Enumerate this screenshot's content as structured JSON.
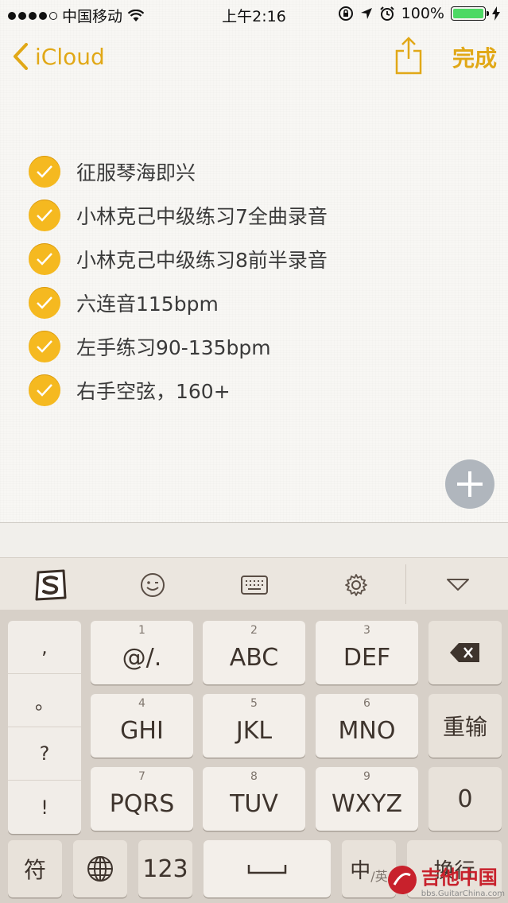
{
  "status": {
    "carrier": "中国移动",
    "time": "上午2:16",
    "battery": "100%"
  },
  "nav": {
    "back_label": "iCloud",
    "done_label": "完成"
  },
  "checklist": [
    "征服琴海即兴",
    "小林克己中级练习7全曲录音",
    "小林克己中级练习8前半录音",
    "六连音115bpm",
    "左手练习90-135bpm",
    "右手空弦，160+"
  ],
  "keyboard": {
    "punct": [
      ",",
      "。",
      "?",
      "!"
    ],
    "row1": [
      {
        "num": "1",
        "label": "@/."
      },
      {
        "num": "2",
        "label": "ABC"
      },
      {
        "num": "3",
        "label": "DEF"
      }
    ],
    "row2": [
      {
        "num": "4",
        "label": "GHI"
      },
      {
        "num": "5",
        "label": "JKL"
      },
      {
        "num": "6",
        "label": "MNO"
      }
    ],
    "row3": [
      {
        "num": "7",
        "label": "PQRS"
      },
      {
        "num": "8",
        "label": "TUV"
      },
      {
        "num": "9",
        "label": "WXYZ"
      }
    ],
    "retype": "重输",
    "zero": "0",
    "symbol": "符",
    "numbers": "123",
    "space": "␣",
    "lang_main": "中",
    "lang_sub": "/英",
    "return": "换行"
  },
  "watermark": {
    "title": "吉他中国",
    "sub": "bbs.GuitarChina.com"
  },
  "colors": {
    "accent": "#e1a817",
    "check": "#f5b920"
  }
}
